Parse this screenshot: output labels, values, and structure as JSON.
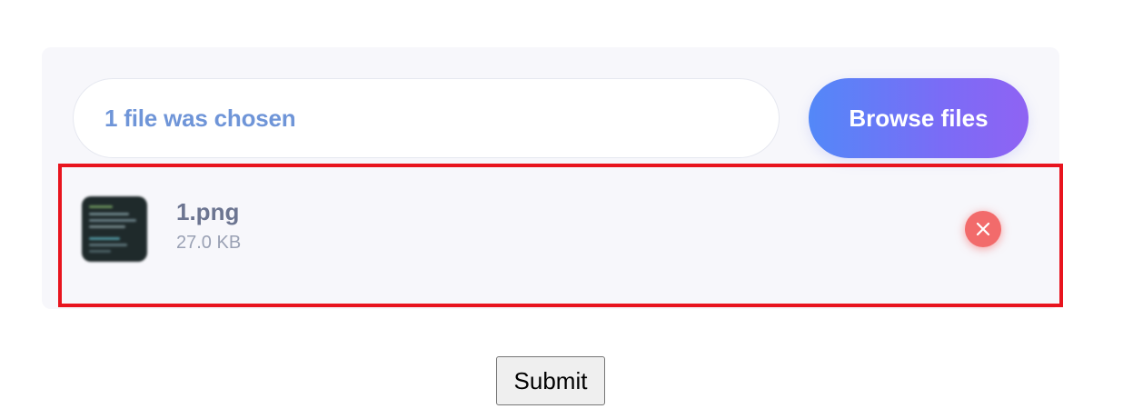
{
  "uploader": {
    "status_text": "1 file was chosen",
    "browse_label": "Browse files",
    "files": [
      {
        "name": "1.png",
        "size": "27.0 KB",
        "thumbnail_icon": "image-thumbnail",
        "remove_icon": "close-icon"
      }
    ]
  },
  "form": {
    "submit_label": "Submit"
  },
  "colors": {
    "status_text": "#6f95d8",
    "browse_gradient_start": "#5388f8",
    "browse_gradient_end": "#8f63f3",
    "remove_button": "#f26b6b",
    "highlight_border": "#e8141e"
  }
}
